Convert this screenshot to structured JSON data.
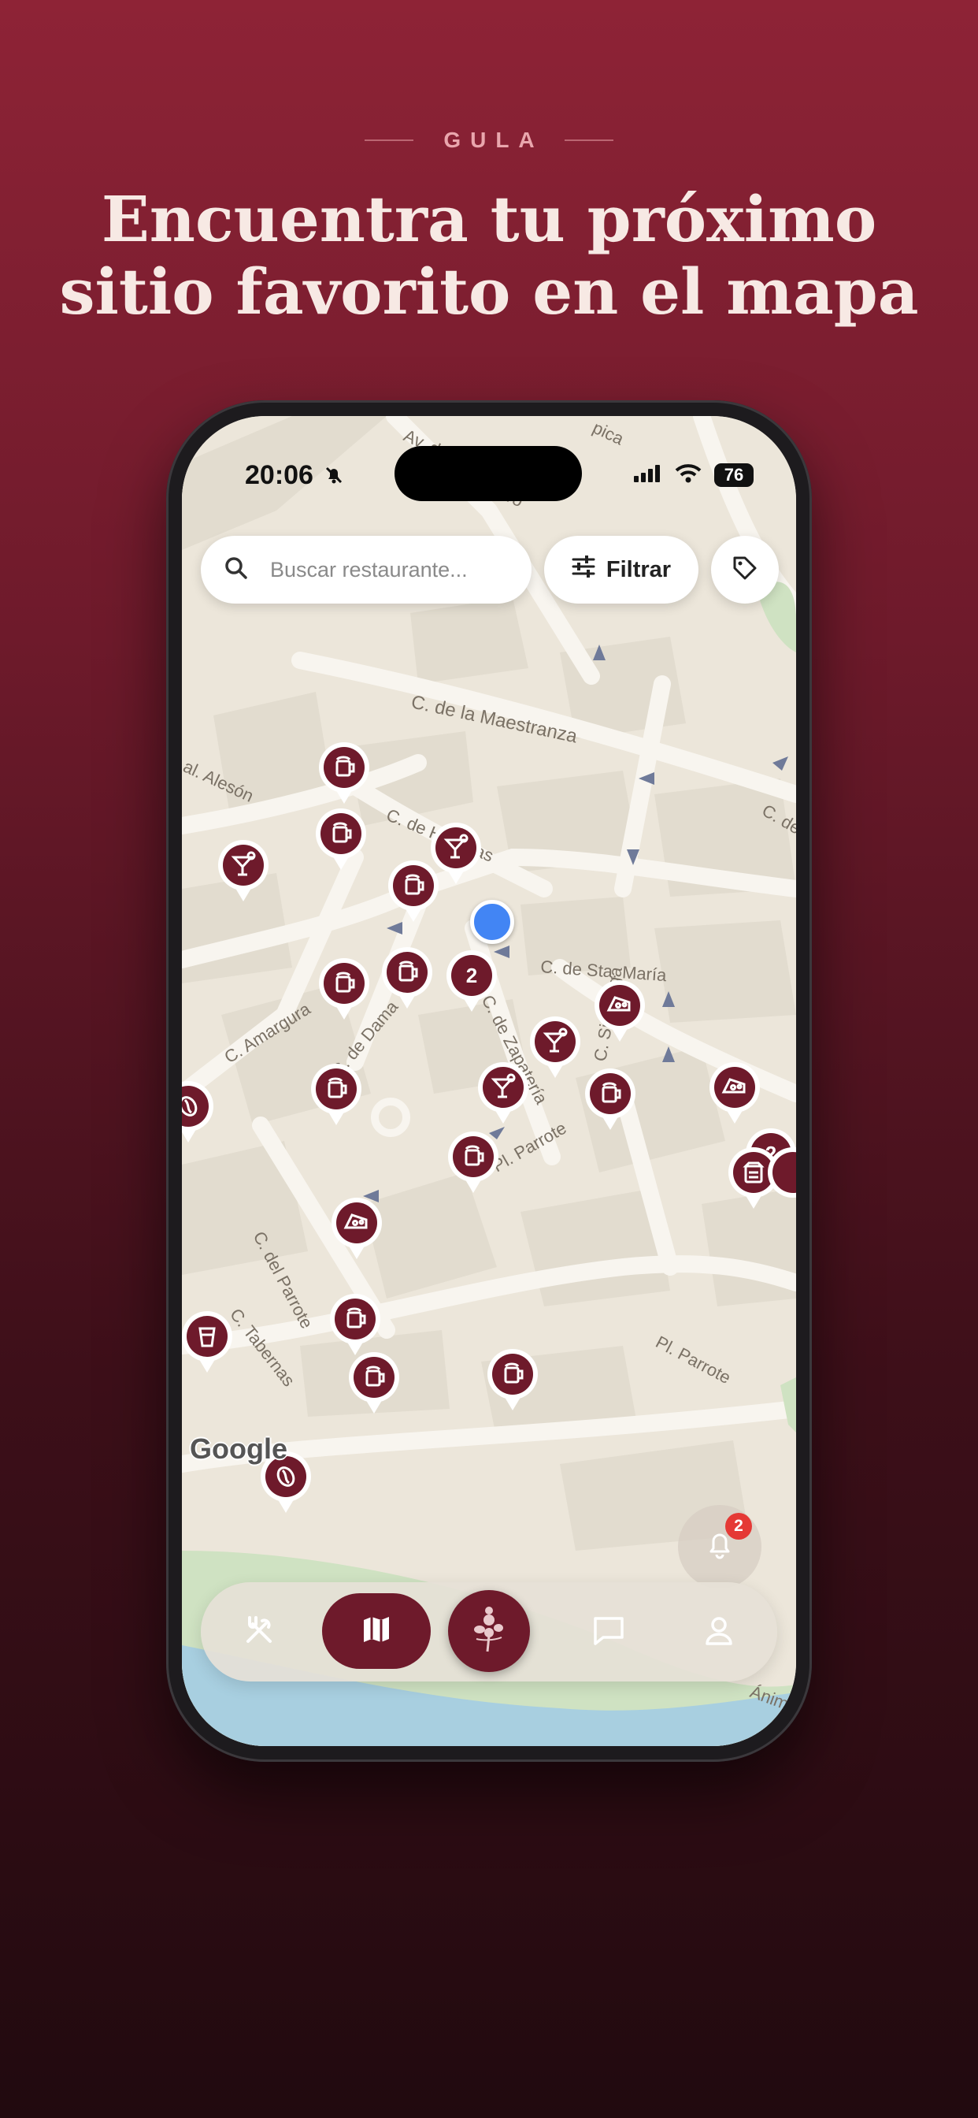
{
  "brand": {
    "name": "GULA"
  },
  "headline": {
    "line1": "Encuentra tu próximo",
    "line2": "sitio favorito en el mapa"
  },
  "status_bar": {
    "time": "20:06",
    "battery": "76"
  },
  "search": {
    "placeholder": "Buscar restaurante..."
  },
  "filter": {
    "label": "Filtrar"
  },
  "map": {
    "attribution": "Google",
    "streets": [
      "Av. d",
      "ndero",
      "pica",
      "C. de la Maestranza",
      "C. de Hornillas",
      "C. de Sta. María",
      "C. Amargura",
      "C. de Dama",
      "C. de Zapatería",
      "C. Sinagoga",
      "Pl. Parrote",
      "C. del Parrote",
      "C. Tabernas",
      "al. Alesón",
      "C. de",
      "Pl. Parrote",
      "Ánim"
    ],
    "clusters": [
      "2",
      "2"
    ]
  },
  "notifications": {
    "count": "2"
  },
  "colors": {
    "brand": "#6e1a2b",
    "accent": "#e9a6ad",
    "user_location": "#4285f4"
  },
  "tabs": [
    {
      "name": "restaurants",
      "icon": "fork-knife-icon"
    },
    {
      "name": "map",
      "icon": "map-icon",
      "active": true
    },
    {
      "name": "home",
      "icon": "gula-logo-icon"
    },
    {
      "name": "chat",
      "icon": "chat-icon"
    },
    {
      "name": "profile",
      "icon": "person-icon"
    }
  ]
}
